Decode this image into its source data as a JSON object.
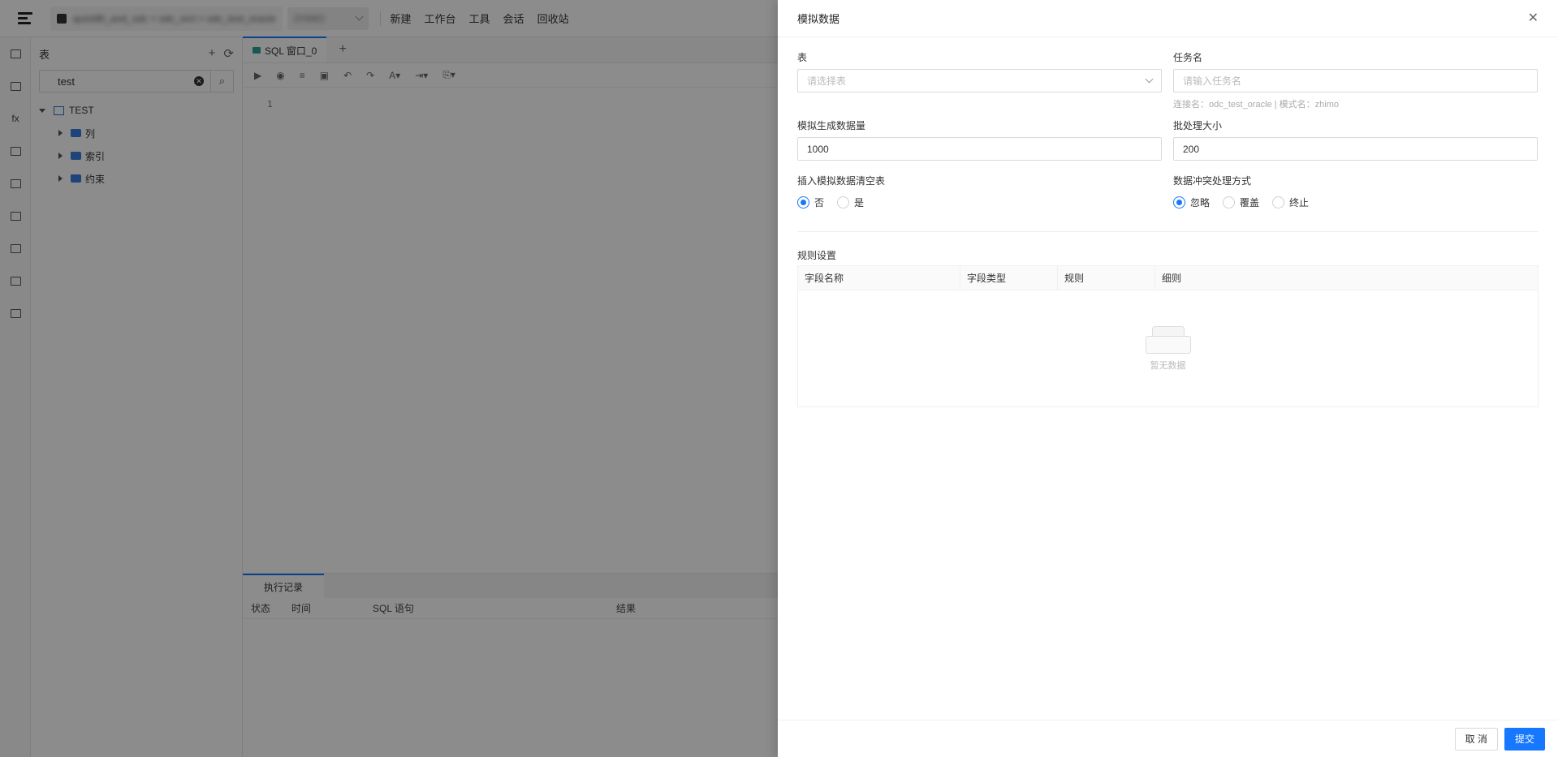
{
  "topbar": {
    "breadcrumb": "quickBI_and_odc > odc_orcl > odc_test_oracle",
    "schema": "ZHIMO",
    "nav": [
      "新建",
      "工作台",
      "工具",
      "会话",
      "回收站"
    ]
  },
  "tree": {
    "title": "表",
    "search_value": "test",
    "root": "TEST",
    "children": [
      "列",
      "索引",
      "约束"
    ]
  },
  "editor": {
    "tab_label": "SQL 窗口_0",
    "line_number": "1"
  },
  "bottom": {
    "tab_label": "执行记录",
    "columns": [
      "状态",
      "时间",
      "SQL 语句",
      "结果"
    ]
  },
  "drawer": {
    "title": "模拟数据",
    "table_label": "表",
    "table_placeholder": "请选择表",
    "task_label": "任务名",
    "task_placeholder": "请输入任务名",
    "connection_hint": "连接名：odc_test_oracle | 模式名：zhimo",
    "count_label": "模拟生成数据量",
    "count_value": "1000",
    "batch_label": "批处理大小",
    "batch_value": "200",
    "clear_label": "插入模拟数据清空表",
    "clear_options": [
      "否",
      "是"
    ],
    "clear_selected": "否",
    "conflict_label": "数据冲突处理方式",
    "conflict_options": [
      "忽略",
      "覆盖",
      "终止"
    ],
    "conflict_selected": "忽略",
    "rules_label": "规则设置",
    "rules_columns": [
      "字段名称",
      "字段类型",
      "规则",
      "细则"
    ],
    "empty_text": "暂无数据",
    "cancel_label": "取 消",
    "submit_label": "提交"
  },
  "colors": {
    "primary": "#1677ff",
    "mask": "rgba(0,0,0,0.45)"
  }
}
